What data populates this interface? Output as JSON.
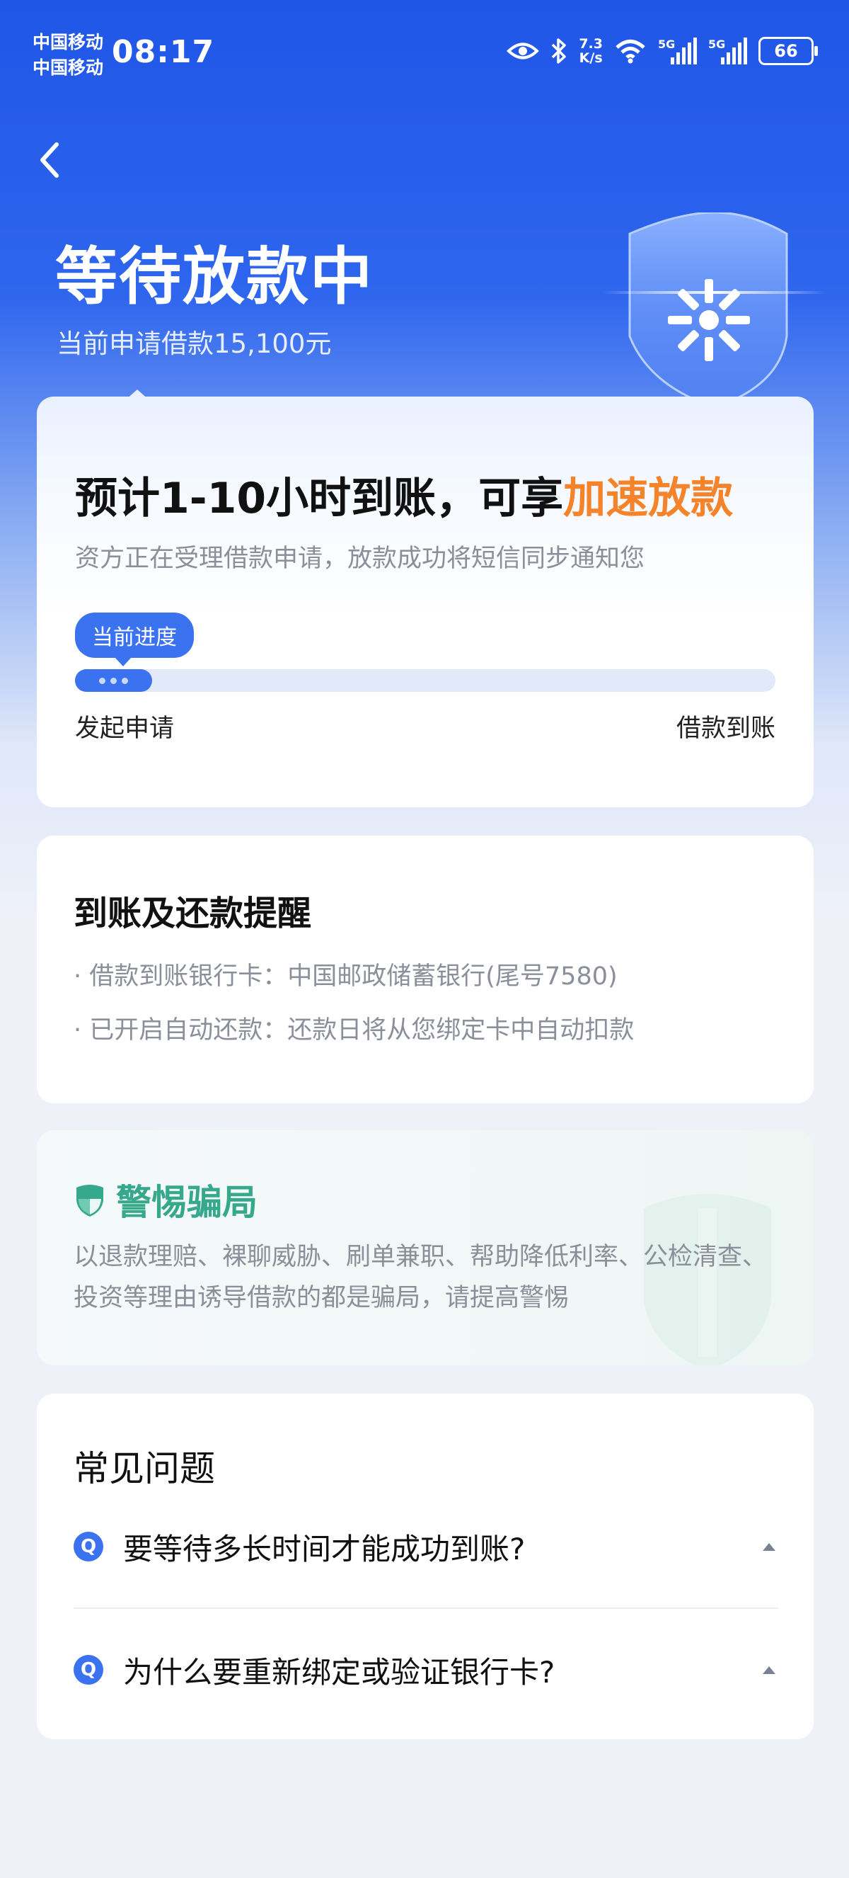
{
  "status_bar": {
    "carrier1": "中国移动",
    "carrier2": "中国移动",
    "time": "08:17",
    "net_speed_value": "7.3",
    "net_speed_unit": "K/s",
    "signal1": "5G",
    "signal2": "5G",
    "battery": "66"
  },
  "header": {
    "title": "等待放款中",
    "subtitle": "当前申请借款15,100元"
  },
  "status_card": {
    "eta_prefix": "预计1-10小时到账，可享",
    "eta_highlight": "加速放款",
    "description": "资方正在受理借款申请，放款成功将短信同步通知您",
    "progress_badge": "当前进度",
    "progress_fraction": 0.11,
    "start_label": "发起申请",
    "end_label": "借款到账"
  },
  "reminder": {
    "title": "到账及还款提醒",
    "items": [
      "· 借款到账银行卡：中国邮政储蓄银行(尾号7580)",
      "· 已开启自动还款：还款日将从您绑定卡中自动扣款"
    ]
  },
  "fraud_warning": {
    "title": "警惕骗局",
    "text": "以退款理赔、裸聊威胁、刷单兼职、帮助降低利率、公检清查、投资等理由诱导借款的都是骗局，请提高警惕"
  },
  "faq": {
    "title": "常见问题",
    "q_badge": "Q",
    "items": [
      {
        "question": "要等待多长时间才能成功到账?"
      },
      {
        "question": "为什么要重新绑定或验证银行卡?"
      }
    ]
  },
  "colors": {
    "primary": "#3a72f0",
    "accent": "#f5832a",
    "safety_green": "#36a88b"
  }
}
